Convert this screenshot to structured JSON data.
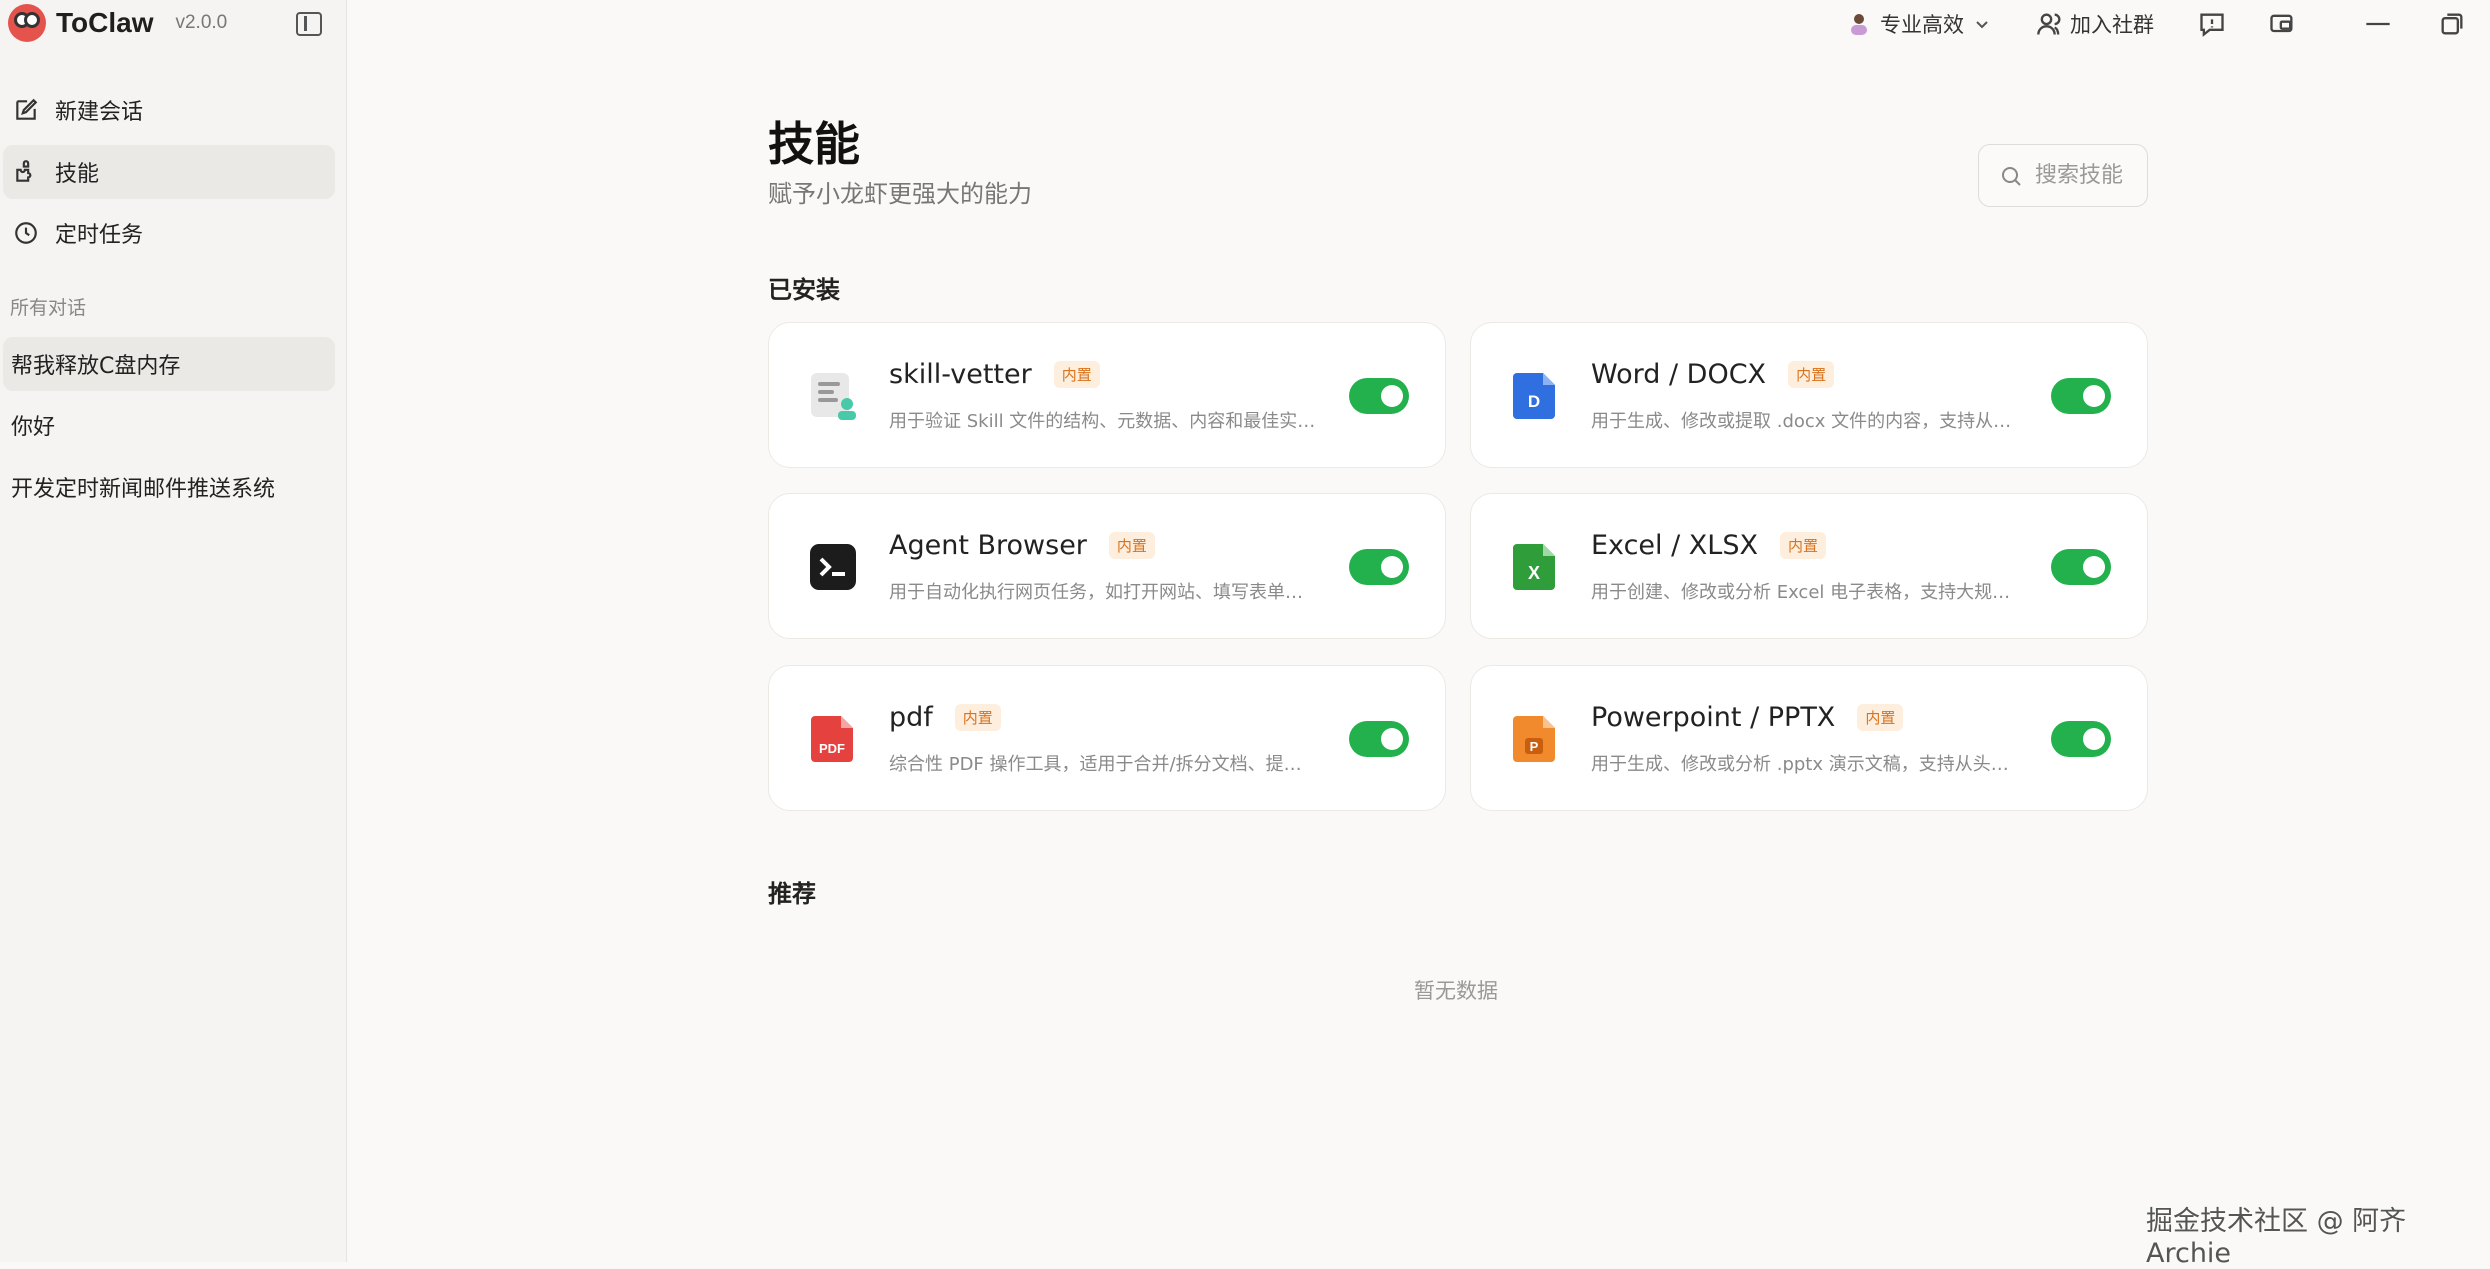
{
  "app": {
    "name": "ToClaw",
    "version": "v2.0.0"
  },
  "sidebar": {
    "nav": [
      {
        "label": "新建会话",
        "icon": "edit-icon"
      },
      {
        "label": "技能",
        "icon": "puzzle-icon"
      },
      {
        "label": "定时任务",
        "icon": "clock-icon"
      }
    ],
    "section_label": "所有对话",
    "conversations": [
      {
        "label": "帮我释放C盘内存"
      },
      {
        "label": "你好"
      },
      {
        "label": "开发定时新闻邮件推送系统"
      }
    ]
  },
  "topbar": {
    "mode_label": "专业高效",
    "community_label": "加入社群"
  },
  "page": {
    "title": "技能",
    "subtitle": "赋予小龙虾更强大的能力",
    "search_placeholder": "搜索技能"
  },
  "installed": {
    "title": "已安装",
    "skills": [
      {
        "name": "skill-vetter",
        "badge": "内置",
        "desc": "用于验证 Skill 文件的结构、元数据、内容和最佳实…",
        "icon": "skill-vetter-icon",
        "enabled": true
      },
      {
        "name": "Word / DOCX",
        "badge": "内置",
        "desc": "用于生成、修改或提取 .docx 文件的内容，支持从头…",
        "icon": "word-doc-icon",
        "enabled": true
      },
      {
        "name": "Agent Browser",
        "badge": "内置",
        "desc": "用于自动化执行网页任务，如打开网站、填写表单、…",
        "icon": "terminal-icon",
        "enabled": true
      },
      {
        "name": "Excel / XLSX",
        "badge": "内置",
        "desc": "用于创建、修改或分析 Excel 电子表格，支持大规模…",
        "icon": "excel-icon",
        "enabled": true
      },
      {
        "name": "pdf",
        "badge": "内置",
        "desc": "综合性 PDF 操作工具，适用于合并/拆分文档、提取…",
        "icon": "pdf-icon",
        "enabled": true
      },
      {
        "name": "Powerpoint / PPTX",
        "badge": "内置",
        "desc": "用于生成、修改或分析 .pptx 演示文稿，支持从头构…",
        "icon": "powerpoint-icon",
        "enabled": true
      }
    ]
  },
  "recommended": {
    "title": "推荐",
    "empty_text": "暂无数据"
  },
  "watermark": "掘金技术社区 @ 阿齐Archie",
  "colors": {
    "toggle_on": "#22b14c",
    "badge_bg": "#fdeedd",
    "badge_text": "#d8731f"
  }
}
